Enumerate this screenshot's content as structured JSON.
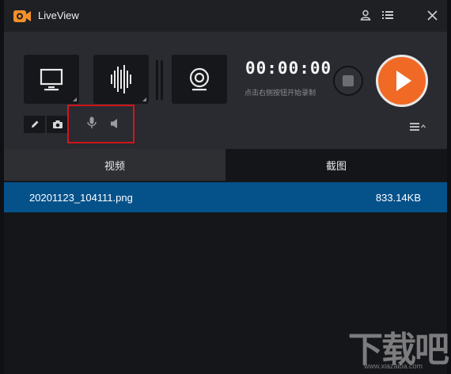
{
  "app": {
    "title": "LiveView",
    "logo_icon": "camera-logo-icon",
    "accent_color": "#f06a26"
  },
  "titlebar": {
    "user_icon": "user-icon",
    "menu_icon": "menu-list-icon",
    "close_icon": "close-icon"
  },
  "controls": {
    "screen_icon": "monitor-icon",
    "audio_icon": "sound-wave-icon",
    "camera_icon": "webcam-icon",
    "timer": "00:00:00",
    "hint": "点击右侧按钮开始录制",
    "stop_icon": "stop-icon",
    "play_icon": "play-icon",
    "edit_icon": "pencil-icon",
    "screenshot_icon": "camera-icon",
    "mic_icon": "microphone-icon",
    "speaker_icon": "speaker-icon",
    "list_toggle_icon": "list-collapse-icon"
  },
  "tabs": [
    {
      "label": "视频",
      "active": true
    },
    {
      "label": "截图",
      "active": false
    }
  ],
  "files": [
    {
      "name": "20201123_104111.png",
      "size": "833.14KB",
      "selected": true
    }
  ],
  "watermark": {
    "text": "下载吧",
    "url": "www.xiazaiba.com"
  },
  "colors": {
    "selection": "#05518a",
    "highlight_box": "#d0161c"
  }
}
